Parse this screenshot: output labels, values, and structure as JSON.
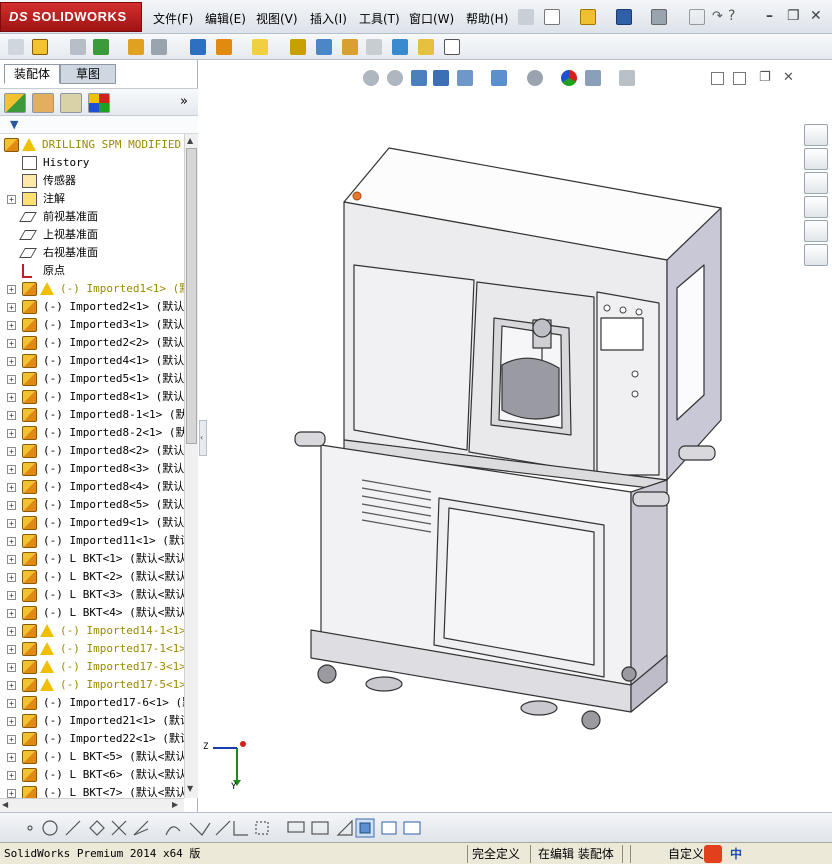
{
  "app": {
    "logo_ds": "DS",
    "logo_text": "SOLIDWORKS"
  },
  "menu": [
    "文件(F)",
    "编辑(E)",
    "视图(V)",
    "插入(I)",
    "工具(T)",
    "窗口(W)",
    "帮助(H)"
  ],
  "window_controls": {
    "minimize": "–",
    "restore": "❐",
    "close": "✕"
  },
  "panel": {
    "tabs": [
      "装配体",
      "草图"
    ],
    "collapse_glyph": "»"
  },
  "tree": [
    {
      "indent": 0,
      "icon": "assembly",
      "warn": true,
      "text": "DRILLING SPM MODIFIED",
      "color": "yellow",
      "expand": ""
    },
    {
      "indent": 1,
      "icon": "history",
      "warn": false,
      "text": "History",
      "expand": ""
    },
    {
      "indent": 1,
      "icon": "sensor",
      "warn": false,
      "text": "传感器",
      "expand": ""
    },
    {
      "indent": 1,
      "icon": "annotation",
      "warn": false,
      "text": "注解",
      "expand": "+"
    },
    {
      "indent": 1,
      "icon": "plane",
      "warn": false,
      "text": "前视基准面",
      "expand": ""
    },
    {
      "indent": 1,
      "icon": "plane",
      "warn": false,
      "text": "上视基准面",
      "expand": ""
    },
    {
      "indent": 1,
      "icon": "plane",
      "warn": false,
      "text": "右视基准面",
      "expand": ""
    },
    {
      "indent": 1,
      "icon": "origin",
      "warn": false,
      "text": "原点",
      "expand": ""
    },
    {
      "indent": 1,
      "icon": "assembly",
      "warn": true,
      "text": "(-) Imported1<1> (默",
      "color": "yellow",
      "expand": "+"
    },
    {
      "indent": 1,
      "icon": "assembly",
      "warn": false,
      "text": "(-) Imported2<1> (默认<",
      "expand": "+"
    },
    {
      "indent": 1,
      "icon": "assembly",
      "warn": false,
      "text": "(-) Imported3<1> (默认<",
      "expand": "+"
    },
    {
      "indent": 1,
      "icon": "assembly",
      "warn": false,
      "text": "(-) Imported2<2> (默认<",
      "expand": "+"
    },
    {
      "indent": 1,
      "icon": "assembly",
      "warn": false,
      "text": "(-) Imported4<1> (默认<",
      "expand": "+"
    },
    {
      "indent": 1,
      "icon": "assembly",
      "warn": false,
      "text": "(-) Imported5<1> (默认<",
      "expand": "+"
    },
    {
      "indent": 1,
      "icon": "assembly",
      "warn": false,
      "text": "(-) Imported8<1> (默认<",
      "expand": "+"
    },
    {
      "indent": 1,
      "icon": "assembly",
      "warn": false,
      "text": "(-) Imported8-1<1> (默认",
      "expand": "+"
    },
    {
      "indent": 1,
      "icon": "assembly",
      "warn": false,
      "text": "(-) Imported8-2<1> (默认",
      "expand": "+"
    },
    {
      "indent": 1,
      "icon": "assembly",
      "warn": false,
      "text": "(-) Imported8<2> (默认<",
      "expand": "+"
    },
    {
      "indent": 1,
      "icon": "assembly",
      "warn": false,
      "text": "(-) Imported8<3> (默认<",
      "expand": "+"
    },
    {
      "indent": 1,
      "icon": "assembly",
      "warn": false,
      "text": "(-) Imported8<4> (默认<",
      "expand": "+"
    },
    {
      "indent": 1,
      "icon": "assembly",
      "warn": false,
      "text": "(-) Imported8<5> (默认<",
      "expand": "+"
    },
    {
      "indent": 1,
      "icon": "assembly",
      "warn": false,
      "text": "(-) Imported9<1> (默认<",
      "expand": "+"
    },
    {
      "indent": 1,
      "icon": "assembly",
      "warn": false,
      "text": "(-) Imported11<1> (默认",
      "expand": "+"
    },
    {
      "indent": 1,
      "icon": "assembly",
      "warn": false,
      "text": "(-) L BKT<1> (默认<默认",
      "expand": "+"
    },
    {
      "indent": 1,
      "icon": "assembly",
      "warn": false,
      "text": "(-) L BKT<2> (默认<默认",
      "expand": "+"
    },
    {
      "indent": 1,
      "icon": "assembly",
      "warn": false,
      "text": "(-) L BKT<3> (默认<默认",
      "expand": "+"
    },
    {
      "indent": 1,
      "icon": "assembly",
      "warn": false,
      "text": "(-) L BKT<4> (默认<默认",
      "expand": "+"
    },
    {
      "indent": 1,
      "icon": "assembly",
      "warn": true,
      "text": "(-) Imported14-1<1>",
      "color": "yellow",
      "expand": "+"
    },
    {
      "indent": 1,
      "icon": "assembly",
      "warn": true,
      "text": "(-) Imported17-1<1>",
      "color": "yellow",
      "expand": "+"
    },
    {
      "indent": 1,
      "icon": "assembly",
      "warn": true,
      "text": "(-) Imported17-3<1>",
      "color": "yellow",
      "expand": "+"
    },
    {
      "indent": 1,
      "icon": "assembly",
      "warn": true,
      "text": "(-) Imported17-5<1>",
      "color": "yellow",
      "expand": "+"
    },
    {
      "indent": 1,
      "icon": "assembly",
      "warn": false,
      "text": "(-) Imported17-6<1> (默",
      "expand": "+"
    },
    {
      "indent": 1,
      "icon": "assembly",
      "warn": false,
      "text": "(-) Imported21<1> (默认",
      "expand": "+"
    },
    {
      "indent": 1,
      "icon": "assembly",
      "warn": false,
      "text": "(-) Imported22<1> (默认",
      "expand": "+"
    },
    {
      "indent": 1,
      "icon": "assembly",
      "warn": false,
      "text": "(-) L BKT<5> (默认<默认",
      "expand": "+"
    },
    {
      "indent": 1,
      "icon": "assembly",
      "warn": false,
      "text": "(-) L BKT<6> (默认<默认",
      "expand": "+"
    },
    {
      "indent": 1,
      "icon": "assembly",
      "warn": false,
      "text": "(-) L BKT<7> (默认<默认",
      "expand": "+"
    }
  ],
  "triad": {
    "x": "Z",
    "y": "Y"
  },
  "status": {
    "product": "SolidWorks Premium 2014 x64 版",
    "defined": "完全定义",
    "editing": "在编辑 装配体",
    "custom": "自定义",
    "ime": "中"
  },
  "colors": {
    "accent": "#c62828",
    "warning": "#f0c000",
    "selection": "#cfe0f5"
  }
}
